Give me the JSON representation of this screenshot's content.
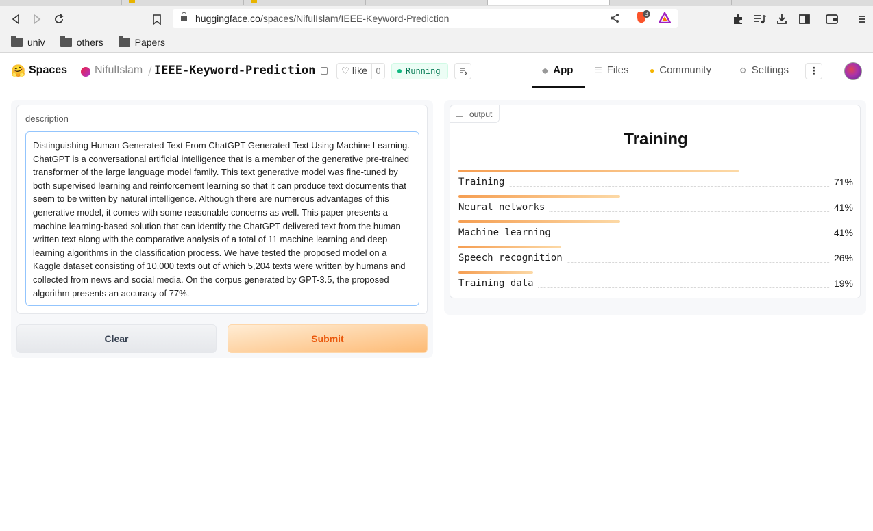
{
  "browser": {
    "url_host": "huggingface.co",
    "url_path": "/spaces/NifulIslam/IEEE-Keyword-Prediction",
    "brave_badge": "3",
    "bookmarks": [
      {
        "label": "univ"
      },
      {
        "label": "others"
      },
      {
        "label": "Papers"
      }
    ]
  },
  "header": {
    "spaces_label": "Spaces",
    "owner": "NifulIslam",
    "separator": "/",
    "repo": "IEEE-Keyword-Prediction",
    "like_label": "like",
    "like_count": "0",
    "status": "Running",
    "tabs": [
      {
        "label": "App",
        "icon": "cube-icon"
      },
      {
        "label": "Files",
        "icon": "files-icon"
      },
      {
        "label": "Community",
        "icon": "community-icon"
      },
      {
        "label": "Settings",
        "icon": "gear-icon"
      }
    ]
  },
  "input": {
    "label": "description",
    "value": "Distinguishing Human Generated Text From ChatGPT Generated Text Using Machine Learning. ChatGPT is a conversational artificial intelligence that is a member of the generative pre-trained transformer of the large language model family. This text generative model was fine-tuned by both supervised learning and reinforcement learning so that it can produce text documents that seem to be written by natural intelligence. Although there are numerous advantages of this generative model, it comes with some reasonable concerns as well. This paper presents a machine learning-based solution that can identify the ChatGPT delivered text from the human written text along with the comparative analysis of a total of 11 machine learning and deep learning algorithms in the classification process. We have tested the proposed model on a Kaggle dataset consisting of 10,000 texts out of which 5,204 texts were written by humans and collected from news and social media. On the corpus generated by GPT-3.5, the proposed algorithm presents an accuracy of 77%."
  },
  "buttons": {
    "clear": "Clear",
    "submit": "Submit"
  },
  "output": {
    "label": "output",
    "top_label": "Training",
    "confidences": [
      {
        "label": "Training",
        "value": 0.71,
        "pct": "71%"
      },
      {
        "label": "Neural networks",
        "value": 0.41,
        "pct": "41%"
      },
      {
        "label": "Machine learning",
        "value": 0.41,
        "pct": "41%"
      },
      {
        "label": "Speech recognition",
        "value": 0.26,
        "pct": "26%"
      },
      {
        "label": "Training data",
        "value": 0.19,
        "pct": "19%"
      }
    ]
  },
  "colors": {
    "accent_orange": "#ea580c",
    "running_green": "#10b981"
  }
}
